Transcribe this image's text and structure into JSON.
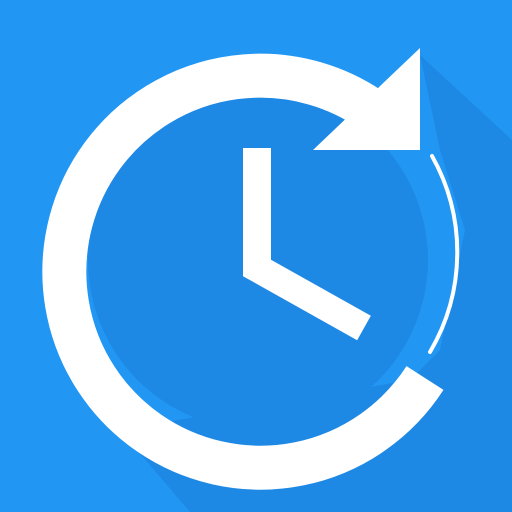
{
  "icon": {
    "name": "clock-refresh-icon",
    "colors": {
      "background": "#2196F3",
      "long_shadow": "#1E88E5",
      "glyph": "#FFFFFF"
    }
  }
}
